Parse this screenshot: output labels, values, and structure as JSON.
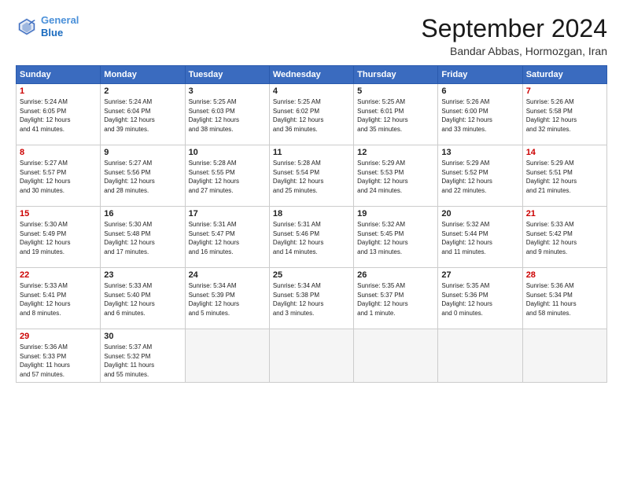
{
  "header": {
    "logo_line1": "General",
    "logo_line2": "Blue",
    "month": "September 2024",
    "location": "Bandar Abbas, Hormozgan, Iran"
  },
  "weekdays": [
    "Sunday",
    "Monday",
    "Tuesday",
    "Wednesday",
    "Thursday",
    "Friday",
    "Saturday"
  ],
  "weeks": [
    [
      {
        "day": "1",
        "info": "Sunrise: 5:24 AM\nSunset: 6:05 PM\nDaylight: 12 hours\nand 41 minutes.",
        "col": "sun"
      },
      {
        "day": "2",
        "info": "Sunrise: 5:24 AM\nSunset: 6:04 PM\nDaylight: 12 hours\nand 39 minutes.",
        "col": "mon"
      },
      {
        "day": "3",
        "info": "Sunrise: 5:25 AM\nSunset: 6:03 PM\nDaylight: 12 hours\nand 38 minutes.",
        "col": "tue"
      },
      {
        "day": "4",
        "info": "Sunrise: 5:25 AM\nSunset: 6:02 PM\nDaylight: 12 hours\nand 36 minutes.",
        "col": "wed"
      },
      {
        "day": "5",
        "info": "Sunrise: 5:25 AM\nSunset: 6:01 PM\nDaylight: 12 hours\nand 35 minutes.",
        "col": "thu"
      },
      {
        "day": "6",
        "info": "Sunrise: 5:26 AM\nSunset: 6:00 PM\nDaylight: 12 hours\nand 33 minutes.",
        "col": "fri"
      },
      {
        "day": "7",
        "info": "Sunrise: 5:26 AM\nSunset: 5:58 PM\nDaylight: 12 hours\nand 32 minutes.",
        "col": "sat"
      }
    ],
    [
      {
        "day": "8",
        "info": "Sunrise: 5:27 AM\nSunset: 5:57 PM\nDaylight: 12 hours\nand 30 minutes.",
        "col": "sun"
      },
      {
        "day": "9",
        "info": "Sunrise: 5:27 AM\nSunset: 5:56 PM\nDaylight: 12 hours\nand 28 minutes.",
        "col": "mon"
      },
      {
        "day": "10",
        "info": "Sunrise: 5:28 AM\nSunset: 5:55 PM\nDaylight: 12 hours\nand 27 minutes.",
        "col": "tue"
      },
      {
        "day": "11",
        "info": "Sunrise: 5:28 AM\nSunset: 5:54 PM\nDaylight: 12 hours\nand 25 minutes.",
        "col": "wed"
      },
      {
        "day": "12",
        "info": "Sunrise: 5:29 AM\nSunset: 5:53 PM\nDaylight: 12 hours\nand 24 minutes.",
        "col": "thu"
      },
      {
        "day": "13",
        "info": "Sunrise: 5:29 AM\nSunset: 5:52 PM\nDaylight: 12 hours\nand 22 minutes.",
        "col": "fri"
      },
      {
        "day": "14",
        "info": "Sunrise: 5:29 AM\nSunset: 5:51 PM\nDaylight: 12 hours\nand 21 minutes.",
        "col": "sat"
      }
    ],
    [
      {
        "day": "15",
        "info": "Sunrise: 5:30 AM\nSunset: 5:49 PM\nDaylight: 12 hours\nand 19 minutes.",
        "col": "sun"
      },
      {
        "day": "16",
        "info": "Sunrise: 5:30 AM\nSunset: 5:48 PM\nDaylight: 12 hours\nand 17 minutes.",
        "col": "mon"
      },
      {
        "day": "17",
        "info": "Sunrise: 5:31 AM\nSunset: 5:47 PM\nDaylight: 12 hours\nand 16 minutes.",
        "col": "tue"
      },
      {
        "day": "18",
        "info": "Sunrise: 5:31 AM\nSunset: 5:46 PM\nDaylight: 12 hours\nand 14 minutes.",
        "col": "wed"
      },
      {
        "day": "19",
        "info": "Sunrise: 5:32 AM\nSunset: 5:45 PM\nDaylight: 12 hours\nand 13 minutes.",
        "col": "thu"
      },
      {
        "day": "20",
        "info": "Sunrise: 5:32 AM\nSunset: 5:44 PM\nDaylight: 12 hours\nand 11 minutes.",
        "col": "fri"
      },
      {
        "day": "21",
        "info": "Sunrise: 5:33 AM\nSunset: 5:42 PM\nDaylight: 12 hours\nand 9 minutes.",
        "col": "sat"
      }
    ],
    [
      {
        "day": "22",
        "info": "Sunrise: 5:33 AM\nSunset: 5:41 PM\nDaylight: 12 hours\nand 8 minutes.",
        "col": "sun"
      },
      {
        "day": "23",
        "info": "Sunrise: 5:33 AM\nSunset: 5:40 PM\nDaylight: 12 hours\nand 6 minutes.",
        "col": "mon"
      },
      {
        "day": "24",
        "info": "Sunrise: 5:34 AM\nSunset: 5:39 PM\nDaylight: 12 hours\nand 5 minutes.",
        "col": "tue"
      },
      {
        "day": "25",
        "info": "Sunrise: 5:34 AM\nSunset: 5:38 PM\nDaylight: 12 hours\nand 3 minutes.",
        "col": "wed"
      },
      {
        "day": "26",
        "info": "Sunrise: 5:35 AM\nSunset: 5:37 PM\nDaylight: 12 hours\nand 1 minute.",
        "col": "thu"
      },
      {
        "day": "27",
        "info": "Sunrise: 5:35 AM\nSunset: 5:36 PM\nDaylight: 12 hours\nand 0 minutes.",
        "col": "fri"
      },
      {
        "day": "28",
        "info": "Sunrise: 5:36 AM\nSunset: 5:34 PM\nDaylight: 11 hours\nand 58 minutes.",
        "col": "sat"
      }
    ],
    [
      {
        "day": "29",
        "info": "Sunrise: 5:36 AM\nSunset: 5:33 PM\nDaylight: 11 hours\nand 57 minutes.",
        "col": "sun"
      },
      {
        "day": "30",
        "info": "Sunrise: 5:37 AM\nSunset: 5:32 PM\nDaylight: 11 hours\nand 55 minutes.",
        "col": "mon"
      },
      {
        "day": "",
        "info": "",
        "col": "empty"
      },
      {
        "day": "",
        "info": "",
        "col": "empty"
      },
      {
        "day": "",
        "info": "",
        "col": "empty"
      },
      {
        "day": "",
        "info": "",
        "col": "empty"
      },
      {
        "day": "",
        "info": "",
        "col": "empty"
      }
    ]
  ]
}
